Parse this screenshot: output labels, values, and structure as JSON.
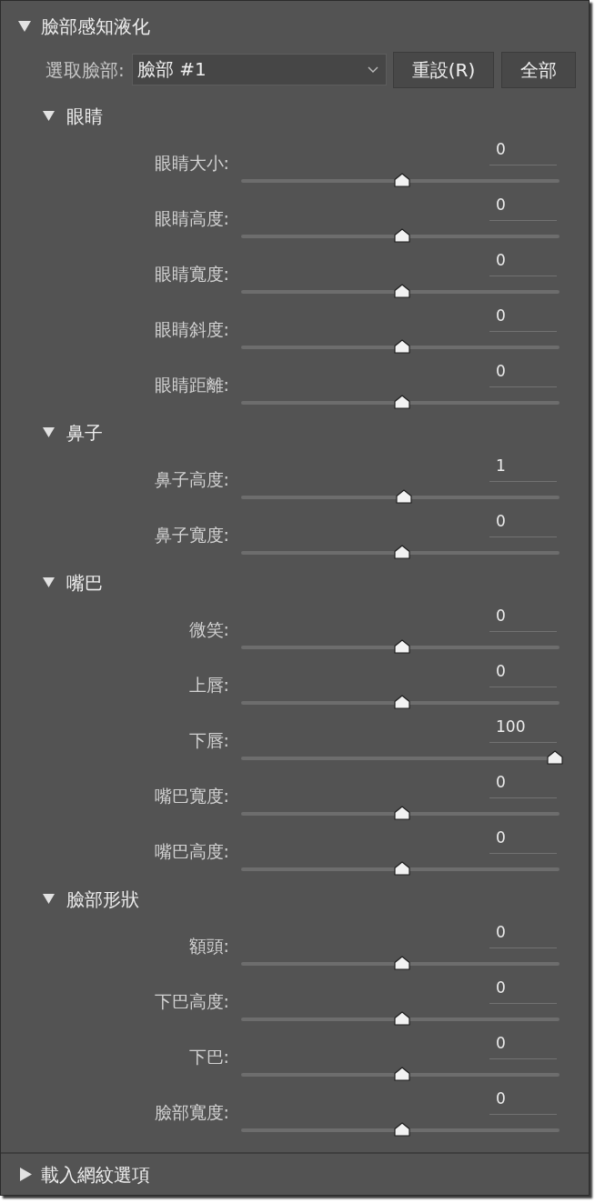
{
  "panel": {
    "title": "臉部感知液化",
    "expanded": true
  },
  "face_select": {
    "label": "選取臉部:",
    "value": "臉部 #1"
  },
  "buttons": [
    {
      "label": "重設(R)"
    },
    {
      "label": "全部"
    }
  ],
  "sections": [
    {
      "title": "眼睛",
      "expanded": true,
      "sliders": [
        {
          "label": "眼睛大小:",
          "value": "0",
          "level": 0.5
        },
        {
          "label": "眼睛高度:",
          "value": "0",
          "level": 0.5
        },
        {
          "label": "眼睛寬度:",
          "value": "0",
          "level": 0.5
        },
        {
          "label": "眼睛斜度:",
          "value": "0",
          "level": 0.5
        },
        {
          "label": "眼睛距離:",
          "value": "0",
          "level": 0.5
        }
      ]
    },
    {
      "title": "鼻子",
      "expanded": true,
      "sliders": [
        {
          "label": "鼻子高度:",
          "value": "1",
          "level": 0.505
        },
        {
          "label": "鼻子寬度:",
          "value": "0",
          "level": 0.5
        }
      ]
    },
    {
      "title": "嘴巴",
      "expanded": true,
      "sliders": [
        {
          "label": "微笑:",
          "value": "0",
          "level": 0.5
        },
        {
          "label": "上唇:",
          "value": "0",
          "level": 0.5
        },
        {
          "label": "下唇:",
          "value": "100",
          "level": 1
        },
        {
          "label": "嘴巴寬度:",
          "value": "0",
          "level": 0.5
        },
        {
          "label": "嘴巴高度:",
          "value": "0",
          "level": 0.5
        }
      ]
    },
    {
      "title": "臉部形狀",
      "expanded": true,
      "sliders": [
        {
          "label": "額頭:",
          "value": "0",
          "level": 0.5
        },
        {
          "label": "下巴高度:",
          "value": "0",
          "level": 0.5
        },
        {
          "label": "下巴:",
          "value": "0",
          "level": 0.5
        },
        {
          "label": "臉部寬度:",
          "value": "0",
          "level": 0.5
        }
      ]
    }
  ],
  "load_mesh": {
    "title": "載入網紋選項",
    "expanded": false
  }
}
